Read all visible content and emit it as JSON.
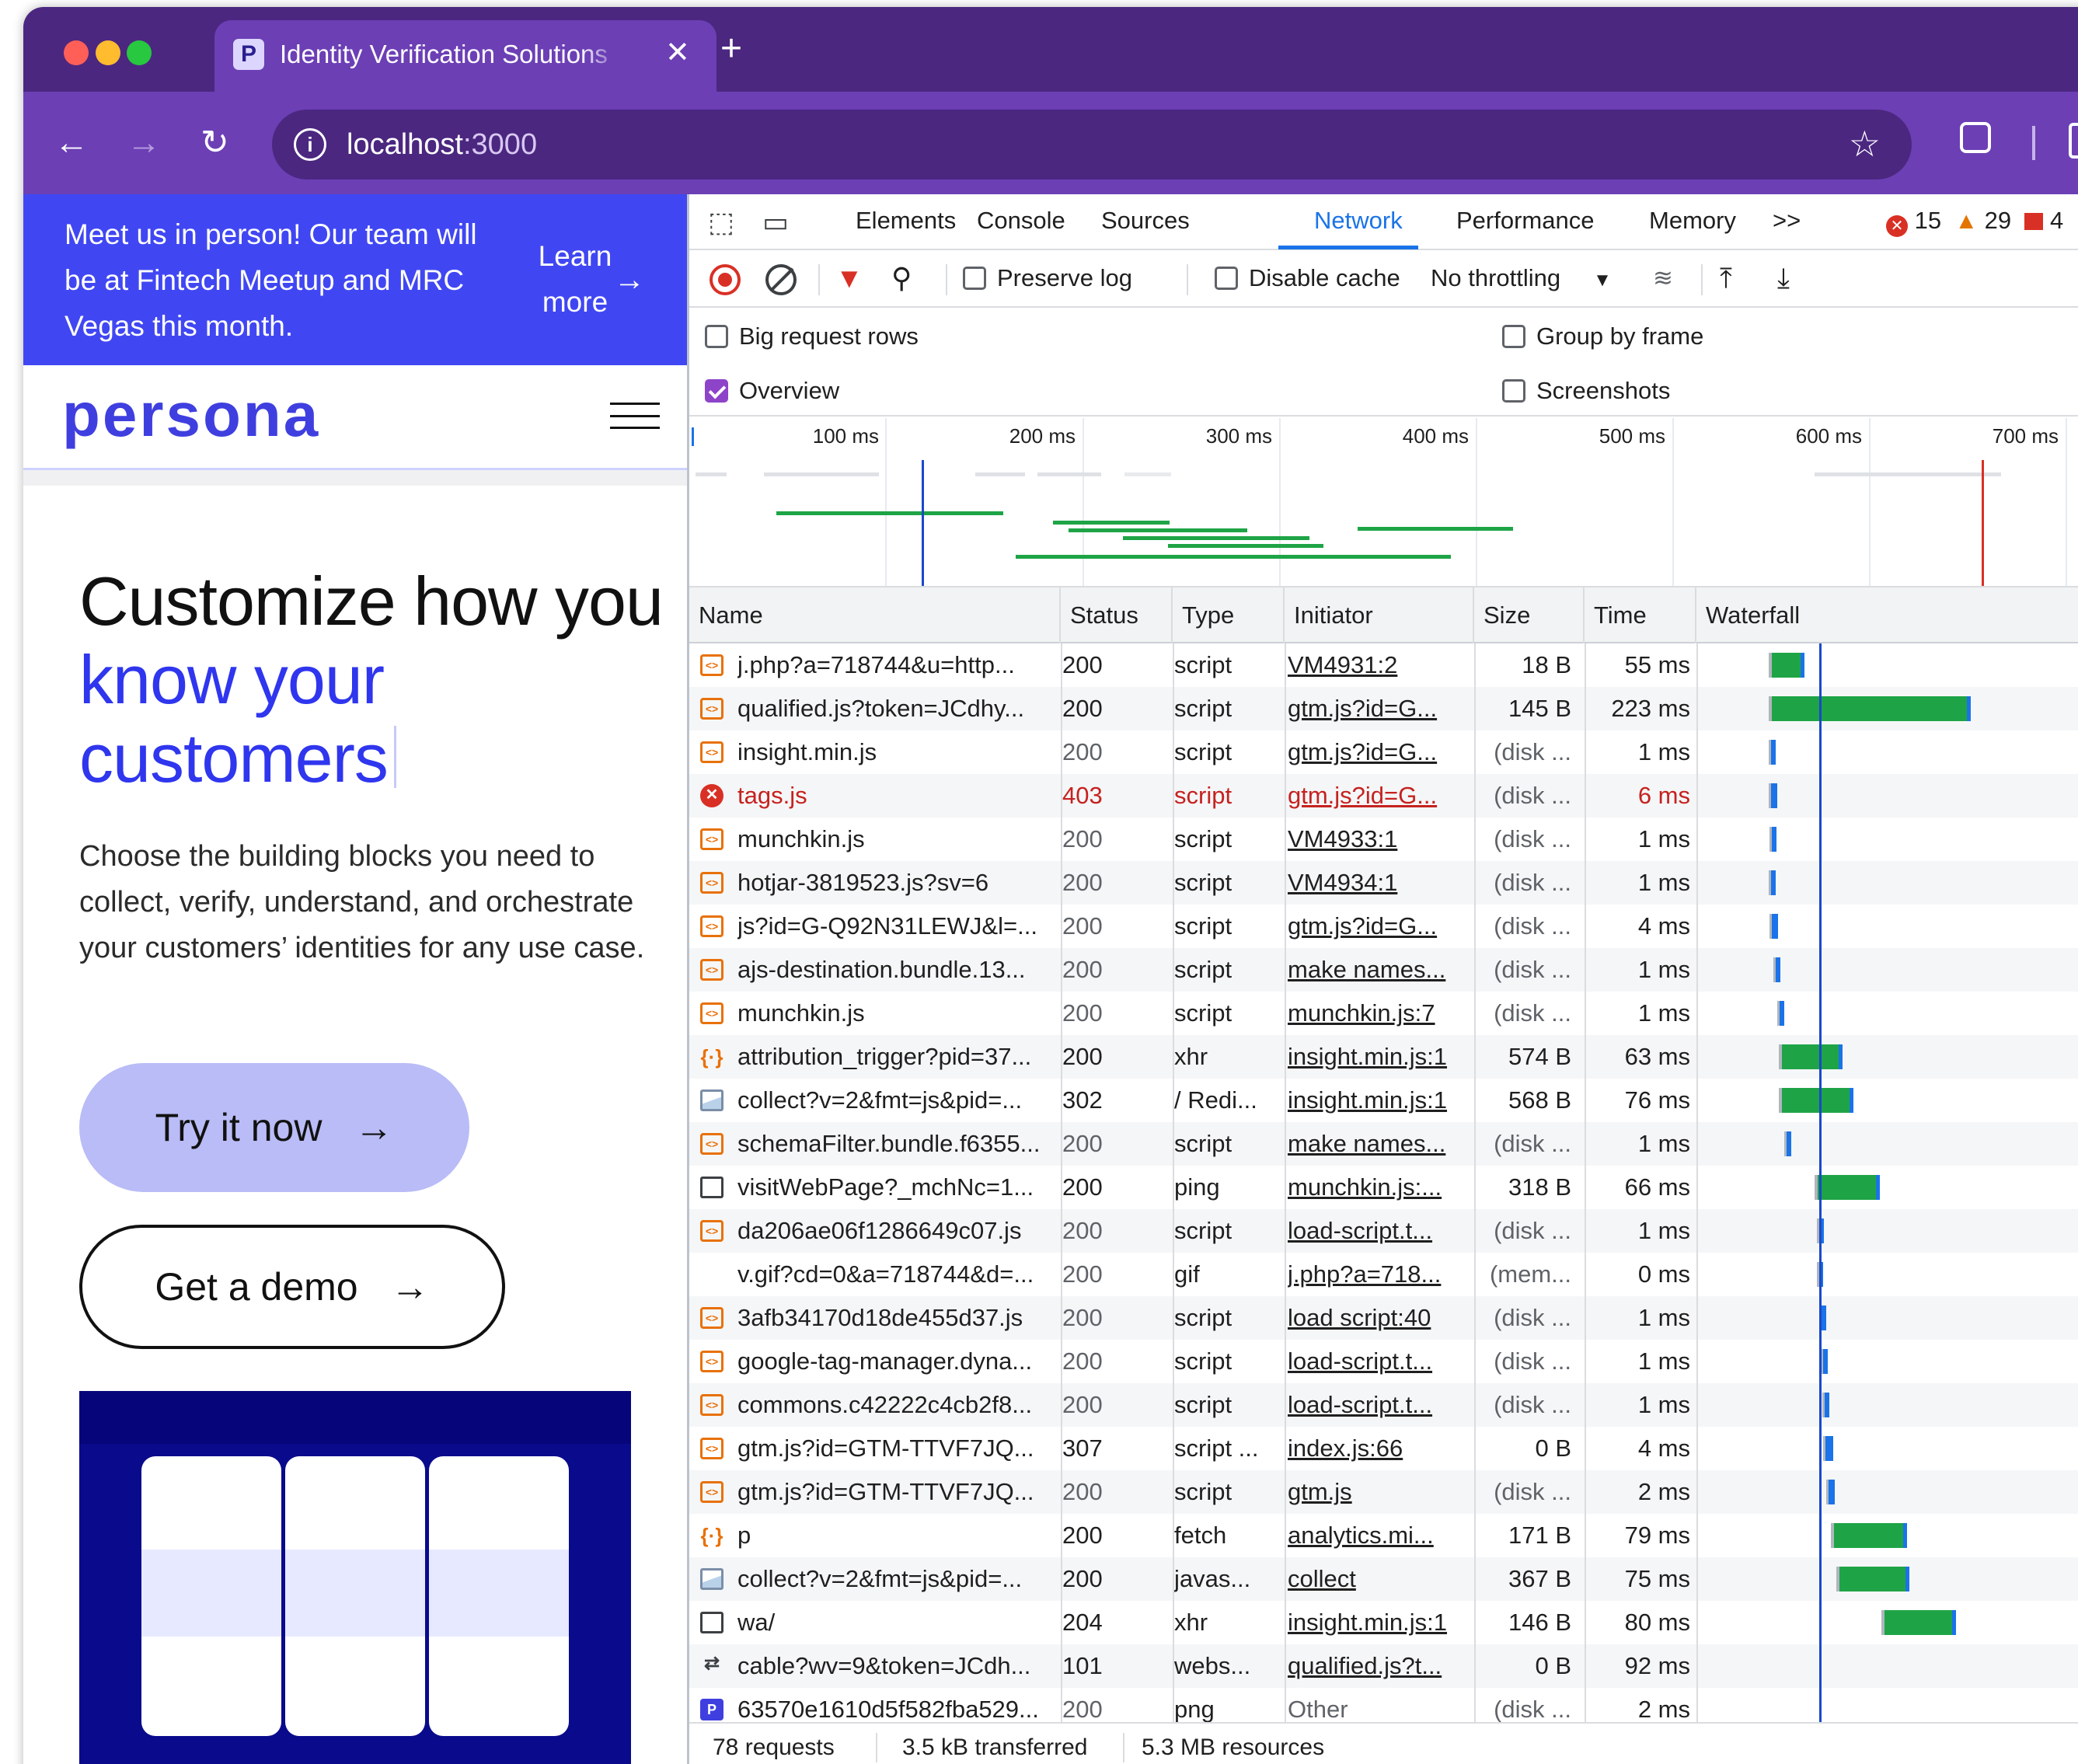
{
  "browser": {
    "tab_title": "Identity Verification Solutions",
    "tab_favicon": "P",
    "url_host": "localhost",
    "url_port": ":3000"
  },
  "icons": {
    "back": "←",
    "forward": "→",
    "reload": "↻",
    "info": "i",
    "star": "☆",
    "close": "✕",
    "new_tab": "+",
    "arrow": "→"
  },
  "site": {
    "banner_text": "Meet us in person! Our team will be at Fintech Meetup and MRC Vegas this month.",
    "banner_cta": "Learn more",
    "logo": "persona",
    "hero_title_1": "Customize how you ",
    "hero_title_hl": "know your customers",
    "hero_body": "Choose the building blocks you need to collect, verify, understand, and orchestrate your customers’ identities for any use case.",
    "primary_cta": "Try it now",
    "secondary_cta": "Get a demo"
  },
  "devtools": {
    "tabs": [
      "Elements",
      "Console",
      "Sources",
      "Network",
      "Performance",
      "Memory"
    ],
    "more_tabs": ">>",
    "errors": "15",
    "warnings": "29",
    "issues": "4",
    "toolbar": {
      "preserve_log": "Preserve log",
      "disable_cache": "Disable cache",
      "throttling": "No throttling"
    },
    "settings": {
      "big_rows": "Big request rows",
      "group_by_frame": "Group by frame",
      "overview": "Overview",
      "screenshots": "Screenshots"
    },
    "timeline_ticks": [
      "100 ms",
      "200 ms",
      "300 ms",
      "400 ms",
      "500 ms",
      "600 ms",
      "700 ms"
    ],
    "columns": [
      "Name",
      "Status",
      "Type",
      "Initiator",
      "Size",
      "Time",
      "Waterfall"
    ],
    "requests": [
      {
        "name": "j.php?a=718744&u=http...",
        "status": "200",
        "type": "script",
        "initiator": "VM4931:2",
        "size": "18 B",
        "time": "55 ms",
        "icon": "script"
      },
      {
        "name": "qualified.js?token=JCdhy...",
        "status": "200",
        "type": "script",
        "initiator": "gtm.js?id=G...",
        "size": "145 B",
        "time": "223 ms",
        "icon": "script"
      },
      {
        "name": "insight.min.js",
        "status": "200",
        "type": "script",
        "initiator": "gtm.js?id=G...",
        "size": "(disk ...",
        "time": "1 ms",
        "icon": "script"
      },
      {
        "name": "tags.js",
        "status": "403",
        "type": "script",
        "initiator": "gtm.js?id=G...",
        "size": "(disk ...",
        "time": "6 ms",
        "icon": "error"
      },
      {
        "name": "munchkin.js",
        "status": "200",
        "type": "script",
        "initiator": "VM4933:1",
        "size": "(disk ...",
        "time": "1 ms",
        "icon": "script"
      },
      {
        "name": "hotjar-3819523.js?sv=6",
        "status": "200",
        "type": "script",
        "initiator": "VM4934:1",
        "size": "(disk ...",
        "time": "1 ms",
        "icon": "script"
      },
      {
        "name": "js?id=G-Q92N31LEWJ&l=...",
        "status": "200",
        "type": "script",
        "initiator": "gtm.js?id=G...",
        "size": "(disk ...",
        "time": "4 ms",
        "icon": "script"
      },
      {
        "name": "ajs-destination.bundle.13...",
        "status": "200",
        "type": "script",
        "initiator": "make names...",
        "size": "(disk ...",
        "time": "1 ms",
        "icon": "script"
      },
      {
        "name": "munchkin.js",
        "status": "200",
        "type": "script",
        "initiator": "munchkin.js:7",
        "size": "(disk ...",
        "time": "1 ms",
        "icon": "script"
      },
      {
        "name": "attribution_trigger?pid=37...",
        "status": "200",
        "type": "xhr",
        "initiator": "insight.min.js:1",
        "size": "574 B",
        "time": "63 ms",
        "icon": "json"
      },
      {
        "name": "collect?v=2&fmt=js&pid=...",
        "status": "302",
        "type": "/ Redi...",
        "initiator": "insight.min.js:1",
        "size": "568 B",
        "time": "76 ms",
        "icon": "img"
      },
      {
        "name": "schemaFilter.bundle.f6355...",
        "status": "200",
        "type": "script",
        "initiator": "make names...",
        "size": "(disk ...",
        "time": "1 ms",
        "icon": "script"
      },
      {
        "name": "visitWebPage?_mchNc=1...",
        "status": "200",
        "type": "ping",
        "initiator": "munchkin.js:...",
        "size": "318 B",
        "time": "66 ms",
        "icon": "box"
      },
      {
        "name": "da206ae06f1286649c07.js",
        "status": "200",
        "type": "script",
        "initiator": "load-script.t...",
        "size": "(disk ...",
        "time": "1 ms",
        "icon": "script"
      },
      {
        "name": "v.gif?cd=0&a=718744&d=...",
        "status": "200",
        "type": "gif",
        "initiator": "j.php?a=718...",
        "size": "(mem...",
        "time": "0 ms",
        "icon": "none"
      },
      {
        "name": "3afb34170d18de455d37.js",
        "status": "200",
        "type": "script",
        "initiator": "load script:40",
        "size": "(disk ...",
        "time": "1 ms",
        "icon": "script"
      },
      {
        "name": "google-tag-manager.dyna...",
        "status": "200",
        "type": "script",
        "initiator": "load-script.t...",
        "size": "(disk ...",
        "time": "1 ms",
        "icon": "script"
      },
      {
        "name": "commons.c42222c4cb2f8...",
        "status": "200",
        "type": "script",
        "initiator": "load-script.t...",
        "size": "(disk ...",
        "time": "1 ms",
        "icon": "script"
      },
      {
        "name": "gtm.js?id=GTM-TTVF7JQ...",
        "status": "307",
        "type": "script ...",
        "initiator": "index.js:66",
        "size": "0 B",
        "time": "4 ms",
        "icon": "script"
      },
      {
        "name": "gtm.js?id=GTM-TTVF7JQ...",
        "status": "200",
        "type": "script",
        "initiator": "gtm.js",
        "size": "(disk ...",
        "time": "2 ms",
        "icon": "script"
      },
      {
        "name": "p",
        "status": "200",
        "type": "fetch",
        "initiator": "analytics.mi...",
        "size": "171 B",
        "time": "79 ms",
        "icon": "json"
      },
      {
        "name": "collect?v=2&fmt=js&pid=...",
        "status": "200",
        "type": "javas...",
        "initiator": "collect",
        "size": "367 B",
        "time": "75 ms",
        "icon": "img"
      },
      {
        "name": "wa/",
        "status": "204",
        "type": "xhr",
        "initiator": "insight.min.js:1",
        "size": "146 B",
        "time": "80 ms",
        "icon": "doc"
      },
      {
        "name": "cable?wv=9&token=JCdh...",
        "status": "101",
        "type": "webs...",
        "initiator": "qualified.js?t...",
        "size": "0 B",
        "time": "92 ms",
        "icon": "ws"
      },
      {
        "name": "63570e1610d5f582fba529...",
        "status": "200",
        "type": "png",
        "initiator": "Other",
        "size": "(disk ...",
        "time": "2 ms",
        "icon": "logo"
      }
    ],
    "status_bar": {
      "requests": "78 requests",
      "transferred": "3.5 kB transferred",
      "resources": "5.3 MB resources"
    }
  }
}
